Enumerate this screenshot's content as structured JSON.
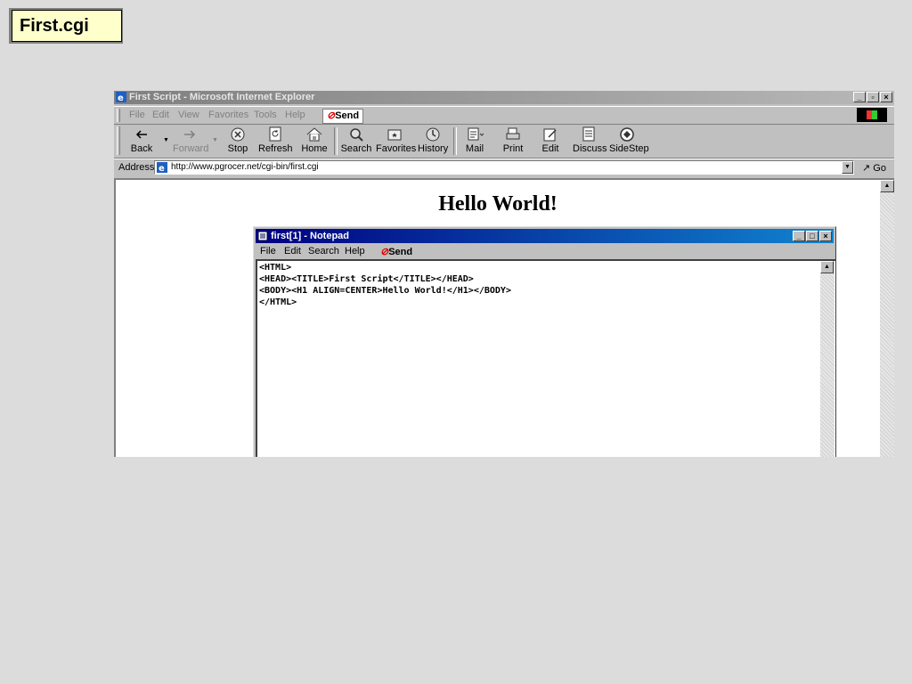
{
  "slide": {
    "title": "First.cgi"
  },
  "browser": {
    "title": "First Script - Microsoft Internet Explorer",
    "menu": [
      "File",
      "Edit",
      "View",
      "Favorites",
      "Tools",
      "Help"
    ],
    "send_label": "Send",
    "toolbar": {
      "back": "Back",
      "forward": "Forward",
      "stop": "Stop",
      "refresh": "Refresh",
      "home": "Home",
      "search": "Search",
      "favorites": "Favorites",
      "history": "History",
      "mail": "Mail",
      "print": "Print",
      "edit": "Edit",
      "discuss": "Discuss",
      "sidestep": "SideStep"
    },
    "address_label": "Address",
    "address_url": "http://www.pgrocer.net/cgi-bin/first.cgi",
    "go_label": "Go",
    "page_heading": "Hello World!"
  },
  "notepad": {
    "title": "first[1] - Notepad",
    "menu": [
      "File",
      "Edit",
      "Search",
      "Help"
    ],
    "send_label": "Send",
    "lines": [
      "<HTML>",
      "<HEAD><TITLE>First Script</TITLE></HEAD>",
      "<BODY><H1 ALIGN=CENTER>Hello World!</H1></BODY>",
      "</HTML>"
    ]
  },
  "colors": {
    "slide_bg": "#dcdcdc",
    "slide_title_bg": "#ffffcc",
    "notepad_titlebar": "#000080",
    "send_clip": "#dd0000"
  }
}
